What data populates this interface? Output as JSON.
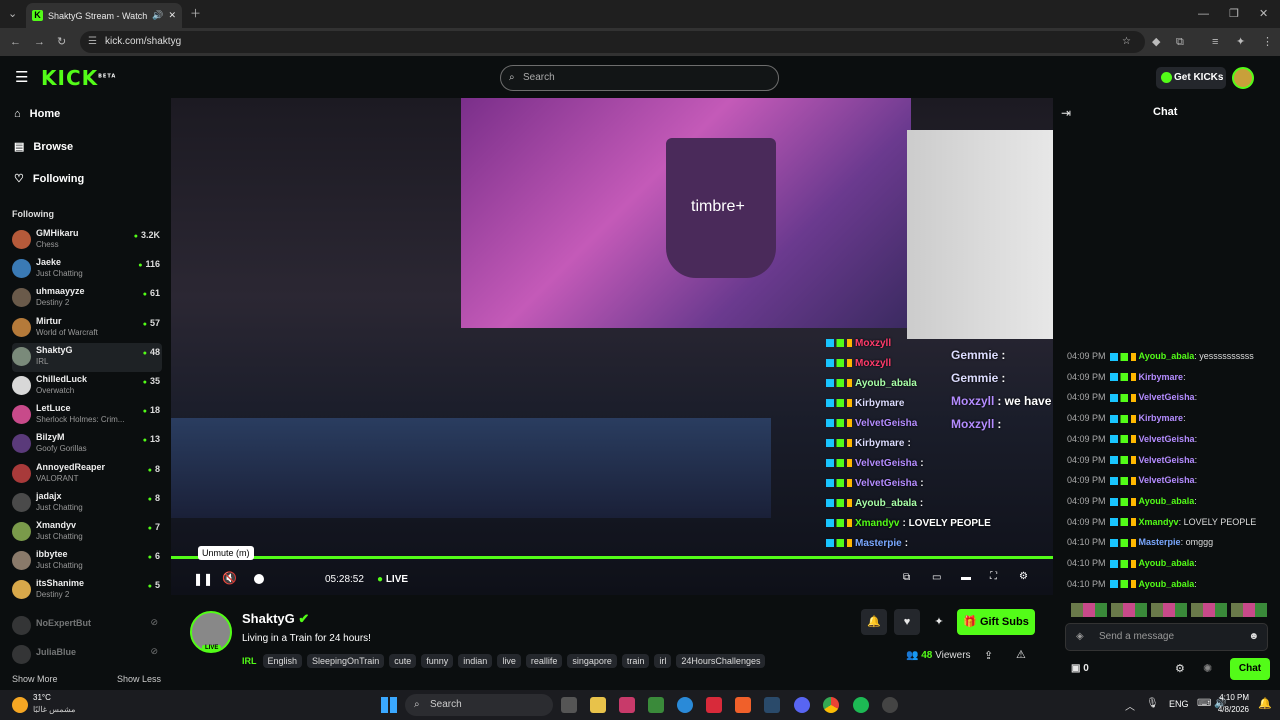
{
  "browser": {
    "tab_title": "ShaktyG Stream - Watch Li",
    "url": "kick.com/shaktyg"
  },
  "header": {
    "logo": "KICK",
    "logo_badge": "BETA",
    "search_placeholder": "Search",
    "get_kicks": "Get KICKs"
  },
  "sidebar": {
    "nav": [
      "Home",
      "Browse",
      "Following"
    ],
    "following_heading": "Following",
    "following": [
      {
        "name": "GMHikaru",
        "category": "Chess",
        "viewers": "3.2K",
        "color": "#b55a3a"
      },
      {
        "name": "Jaeke",
        "category": "Just Chatting",
        "viewers": "116",
        "color": "#3a7ab5"
      },
      {
        "name": "uhmaayyze",
        "category": "Destiny 2",
        "viewers": "61",
        "color": "#6a5a4a"
      },
      {
        "name": "Mirtur",
        "category": "World of Warcraft",
        "viewers": "57",
        "color": "#b57a3a"
      },
      {
        "name": "ShaktyG",
        "category": "IRL",
        "viewers": "48",
        "color": "#7a8a7a"
      },
      {
        "name": "ChilledLuck",
        "category": "Overwatch",
        "viewers": "35",
        "color": "#d8d8d8"
      },
      {
        "name": "LetLuce",
        "category": "Sherlock Holmes: Crim...",
        "viewers": "18",
        "color": "#c84a8a"
      },
      {
        "name": "BilzyM",
        "category": "Goofy Gorillas",
        "viewers": "13",
        "color": "#5a3a7a"
      },
      {
        "name": "AnnoyedReaper",
        "category": "VALORANT",
        "viewers": "8",
        "color": "#a83a3a"
      },
      {
        "name": "jadajx",
        "category": "Just Chatting",
        "viewers": "8",
        "color": "#4a4a4a"
      },
      {
        "name": "Xmandyv",
        "category": "Just Chatting",
        "viewers": "7",
        "color": "#7a9a4a"
      },
      {
        "name": "ibbytee",
        "category": "Just Chatting",
        "viewers": "6",
        "color": "#8a7a6a"
      },
      {
        "name": "itsShanime",
        "category": "Destiny 2",
        "viewers": "5",
        "color": "#d8a84a"
      }
    ],
    "offline": [
      "NoExpertBut",
      "JuliaBlue"
    ],
    "show_more": "Show More",
    "show_less": "Show Less"
  },
  "video": {
    "cup_text": "timbre+",
    "time": "05:28:52",
    "live": "LIVE",
    "tooltip": "Unmute (m)",
    "overlay_chat": [
      {
        "user": "Moxzyll",
        "msg": "",
        "color": "#ff3b6b"
      },
      {
        "user": "Moxzyll",
        "msg": "",
        "color": "#ff3b6b"
      },
      {
        "user": "Ayoub_abala",
        "msg": "",
        "color": "#a8ffa8"
      },
      {
        "user": "Kirbymare",
        "msg": "",
        "color": "#dcdcff"
      },
      {
        "user": "VelvetGeisha",
        "msg": "",
        "color": "#b48cff"
      },
      {
        "user": "Kirbymare",
        "msg": ":",
        "color": "#dcdcff"
      },
      {
        "user": "VelvetGeisha",
        "msg": ":",
        "color": "#b48cff"
      },
      {
        "user": "VelvetGeisha",
        "msg": ":",
        "color": "#b48cff"
      },
      {
        "user": "Ayoub_abala",
        "msg": ":",
        "color": "#a8ffa8"
      },
      {
        "user": "Xmandyv",
        "msg": ": LOVELY PEOPLE",
        "color": "#53fc18"
      },
      {
        "user": "Masterpie",
        "msg": ":",
        "color": "#7aa8ff"
      }
    ],
    "overlay_big": [
      {
        "user": "Gemmie",
        "msg": ":"
      },
      {
        "user": "Gemmie",
        "msg": ":"
      },
      {
        "user": "Moxzyll",
        "msg": ": we have to pay up now"
      },
      {
        "user": "Moxzyll",
        "msg": ":"
      }
    ]
  },
  "stream": {
    "streamer": "ShaktyG",
    "title": "Living in a Train for 24 hours!",
    "live_badge": "LIVE",
    "category": "IRL",
    "tags": [
      "English",
      "SleepingOnTrain",
      "cute",
      "funny",
      "indian",
      "live",
      "reallife",
      "singapore",
      "train",
      "irl",
      "24HoursChallenges"
    ],
    "viewers": "48",
    "viewers_label": "Viewers",
    "gift_subs": "Gift Subs"
  },
  "chat": {
    "title": "Chat",
    "messages": [
      {
        "time": "04:09 PM",
        "user": "Ayoub_abala",
        "msg": ": yessssssssss",
        "color": "#53fc18"
      },
      {
        "time": "04:09 PM",
        "user": "Kirbymare",
        "msg": ":",
        "color": "#b48cff"
      },
      {
        "time": "04:09 PM",
        "user": "VelvetGeisha",
        "msg": ":",
        "color": "#b48cff"
      },
      {
        "time": "04:09 PM",
        "user": "Kirbymare",
        "msg": ":",
        "color": "#b48cff"
      },
      {
        "time": "04:09 PM",
        "user": "VelvetGeisha",
        "msg": ":",
        "color": "#b48cff"
      },
      {
        "time": "04:09 PM",
        "user": "VelvetGeisha",
        "msg": ":",
        "color": "#b48cff"
      },
      {
        "time": "04:09 PM",
        "user": "VelvetGeisha",
        "msg": ":",
        "color": "#b48cff"
      },
      {
        "time": "04:09 PM",
        "user": "Ayoub_abala",
        "msg": ":",
        "color": "#53fc18"
      },
      {
        "time": "04:09 PM",
        "user": "Xmandyv",
        "msg": ": LOVELY PEOPLE",
        "color": "#53fc18"
      },
      {
        "time": "04:10 PM",
        "user": "Masterpie",
        "msg": ": omggg",
        "color": "#7aa8ff"
      },
      {
        "time": "04:10 PM",
        "user": "Ayoub_abala",
        "msg": ":",
        "color": "#53fc18"
      },
      {
        "time": "04:10 PM",
        "user": "Ayoub_abala",
        "msg": ":",
        "color": "#53fc18"
      }
    ],
    "send_placeholder": "Send a message",
    "kicks_count": "0",
    "chat_button": "Chat"
  },
  "taskbar": {
    "weather_temp": "31°C",
    "weather_desc": "مشمس غالبًا",
    "search": "Search",
    "lang": "ENG",
    "time": "4:10 PM",
    "date": "4/8/2026"
  }
}
